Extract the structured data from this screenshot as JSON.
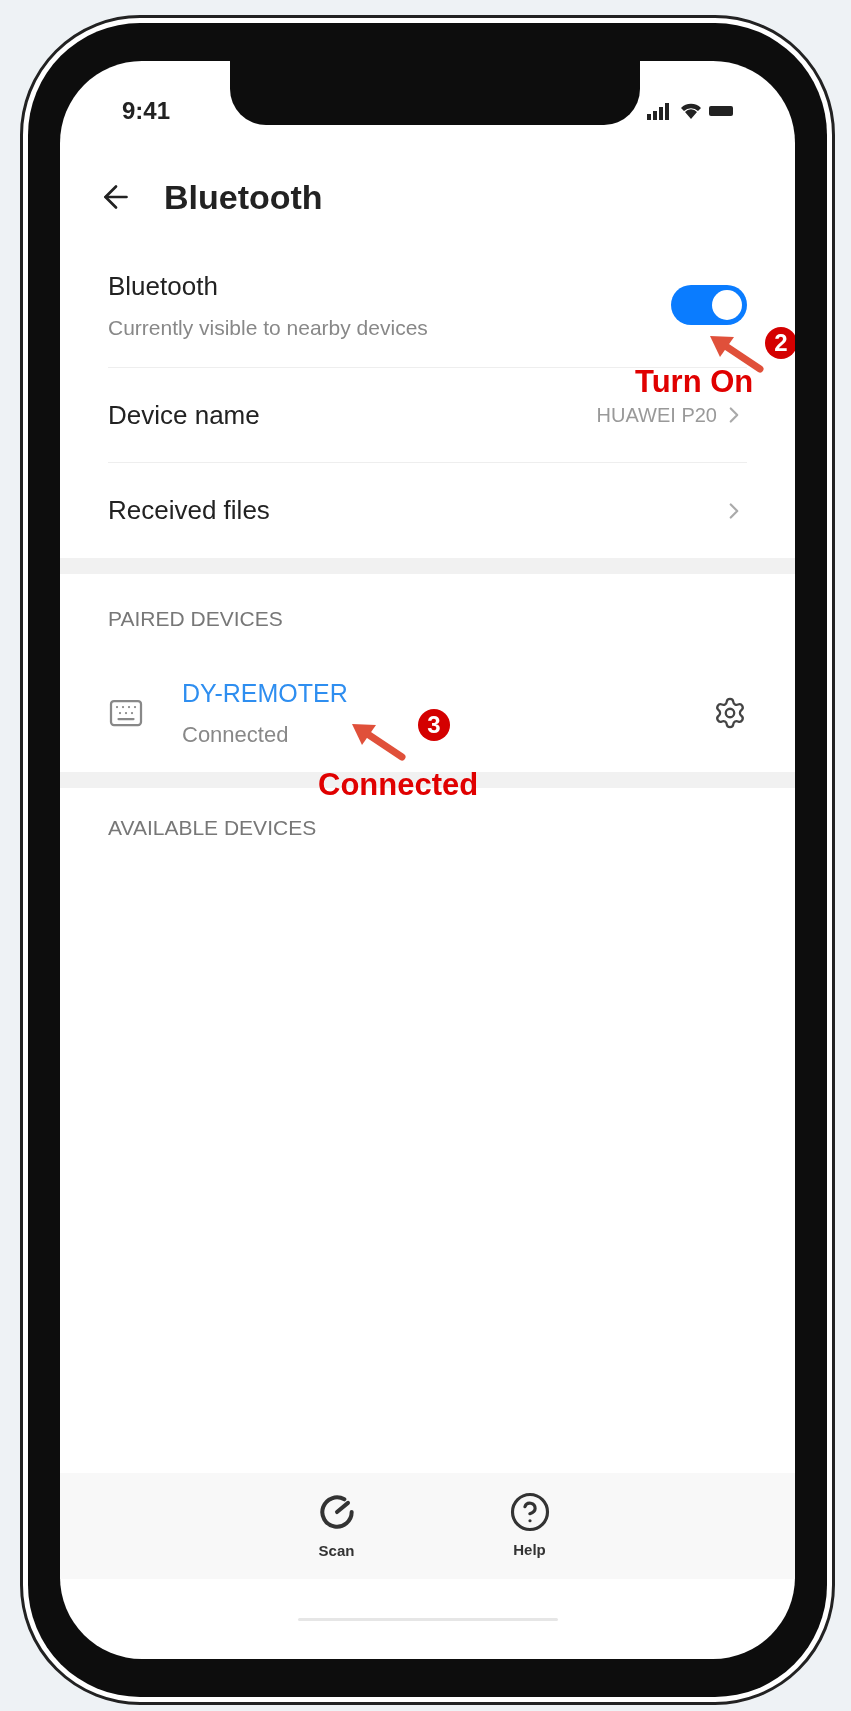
{
  "status_bar": {
    "time": "9:41"
  },
  "header": {
    "title": "Bluetooth"
  },
  "bluetooth_row": {
    "label": "Bluetooth",
    "subtitle": "Currently visible to nearby devices",
    "on": true
  },
  "settings_rows": [
    {
      "label": "Device name",
      "value": "HUAWEI P20"
    },
    {
      "label": "Received files"
    }
  ],
  "paired_devices": {
    "heading": "PAIRED DEVICES",
    "devices": [
      {
        "name": "DY-REMOTER",
        "status": "Connected",
        "connected": true
      }
    ]
  },
  "available_devices": {
    "heading": "AVAILABLE DEVICES"
  },
  "bottom_actions": [
    {
      "kind": "scan",
      "label": "Scan"
    },
    {
      "kind": "help",
      "label": "Help"
    }
  ],
  "annotations": [
    {
      "number": "2",
      "label": "Turn On"
    },
    {
      "number": "3",
      "label": "Connected"
    }
  ]
}
